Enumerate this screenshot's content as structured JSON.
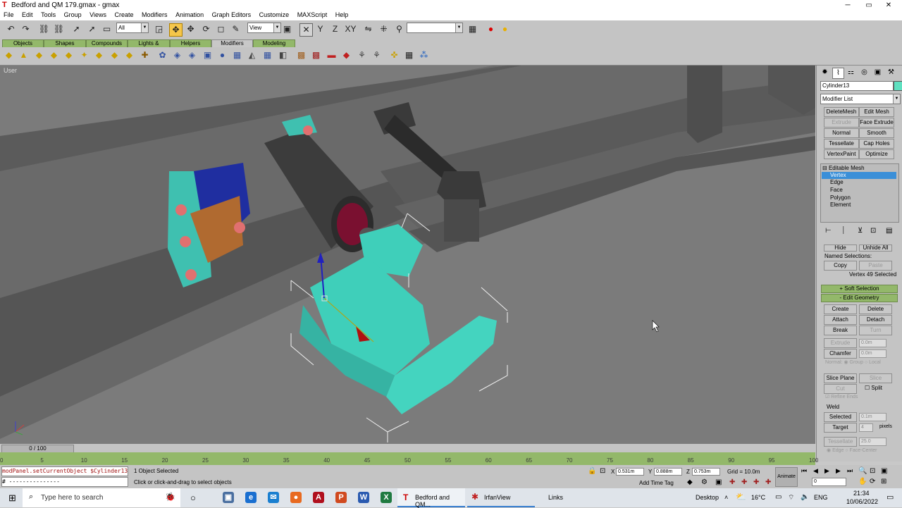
{
  "window": {
    "title": "Bedford and QM 179.gmax - gmax",
    "minimize": "─",
    "maximize": "▭",
    "close": "✕"
  },
  "menu": [
    "File",
    "Edit",
    "Tools",
    "Group",
    "Views",
    "Create",
    "Modifiers",
    "Animation",
    "Graph Editors",
    "Customize",
    "MAXScript",
    "Help"
  ],
  "toolbar": {
    "selection_filter": "All",
    "ref_coord": "View",
    "named_selection": ""
  },
  "tabs": [
    "Objects",
    "Shapes",
    "Compounds",
    "Lights & Cameras",
    "Helpers",
    "Modifiers",
    "Modeling"
  ],
  "active_tab": "Modifiers",
  "viewport": {
    "label": "User"
  },
  "panel": {
    "object_name": "Cylinder13",
    "object_color": "#5fe0c0",
    "modifier_list": "Modifier List",
    "modifier_buttons": [
      "DeleteMesh",
      "Edit Mesh",
      "Extrude",
      "Face Extrude",
      "Normal",
      "Smooth",
      "Tessellate",
      "Cap Holes",
      "VertexPaint",
      "Optimize"
    ],
    "stack_title": "Editable Mesh",
    "stack_items": [
      "Vertex",
      "Edge",
      "Face",
      "Polygon",
      "Element"
    ],
    "hide": "Hide",
    "unhide_all": "Unhide All",
    "named_selections": "Named Selections:",
    "copy": "Copy",
    "paste": "Paste",
    "selection_info": "Vertex 49 Selected",
    "soft_selection": "Soft Selection",
    "edit_geometry": "Edit Geometry",
    "create": "Create",
    "delete": "Delete",
    "attach": "Attach",
    "detach": "Detach",
    "break": "Break",
    "turn": "Turn",
    "extrude": "Extrude",
    "extrude_val": "0.0m",
    "chamfer": "Chamfer",
    "chamfer_val": "0.0m",
    "normal_opt": "Normal",
    "group_opt": "Group",
    "local_opt": "Local",
    "slice_plane": "Slice Plane",
    "slice": "Slice",
    "cut": "Cut",
    "split": "Split",
    "refine_ends": "Refine Ends",
    "weld": "Weld",
    "selected": "Selected",
    "selected_val": "0.1m",
    "target": "Target",
    "target_val": "4",
    "pixels": "pixels",
    "tessellate": "Tessellate",
    "tess_val": "25.0",
    "edge": "Edge",
    "face_center": "Face-Center"
  },
  "timeline": {
    "frame": "0 / 100",
    "ticks": [
      "0",
      "5",
      "10",
      "15",
      "20",
      "25",
      "30",
      "35",
      "40",
      "45",
      "50",
      "55",
      "60",
      "65",
      "70",
      "75",
      "80",
      "85",
      "90",
      "95",
      "100"
    ]
  },
  "status": {
    "script_line1": "modPanel.setCurrentObject $Cylinder13.",
    "script_line2": "# ---------------",
    "selection": "1 Object Selected",
    "prompt": "Click or click-and-drag to select objects",
    "x_label": "X",
    "x": "0.531m",
    "y_label": "Y",
    "y": "0.888m",
    "z_label": "Z",
    "z": "0.753m",
    "grid": "Grid = 10.0m",
    "add_time_tag": "Add Time Tag",
    "animate": "Animate",
    "frame_field": "0"
  },
  "taskbar": {
    "search": "Type here to search",
    "app1": "Bedford and QM...",
    "app2": "IrfanView",
    "links": "Links",
    "desktop": "Desktop",
    "temp": "16°C",
    "lang": "ENG",
    "time": "21:34",
    "date": "10/06/2022"
  }
}
